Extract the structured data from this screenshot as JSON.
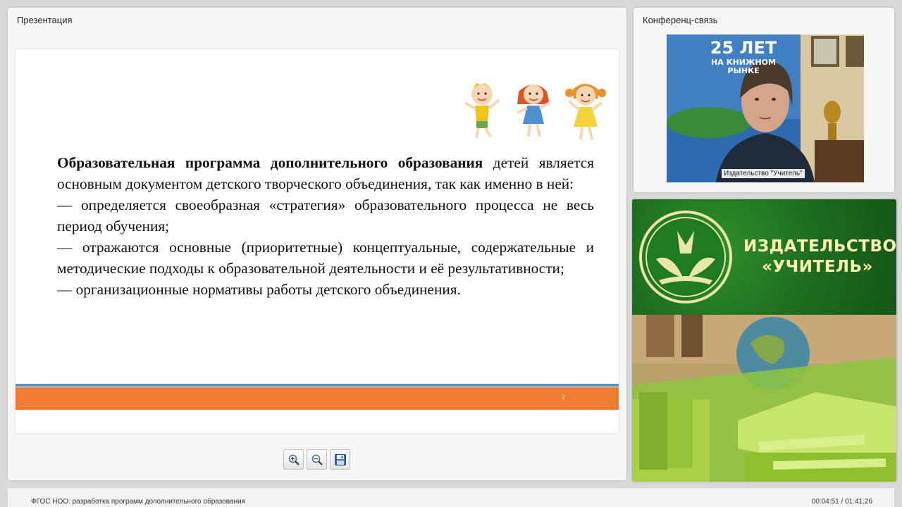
{
  "presentation_panel": {
    "title": "Презентация"
  },
  "slide": {
    "paragraph1_bold": "Образовательная программа дополнительного образования",
    "paragraph1_rest": " детей является основным документом детского творческого объединения, так как именно в ней:",
    "bullet1": "— определяется своеобразная «стратегия» образовательного процесса не весь период обучения;",
    "bullet2": "— отражаются основные (приоритетные) концептуальные, содержательные и методические подходы к образовательной деятельности и её результативности;",
    "bullet3": "— организационные нормативы работы детского объединения.",
    "page_number": "2"
  },
  "toolbar": {
    "zoom_in_icon": "zoom-in-icon",
    "zoom_out_icon": "zoom-out-icon",
    "save_icon": "floppy-disk-icon"
  },
  "conference_panel": {
    "title": "Конференц-связь",
    "participant_label": "Издательство \"Учитель\"",
    "banner_lines": [
      "25 ЛЕТ",
      "НА КНИЖНОМ",
      "РЫНКЕ"
    ]
  },
  "brand": {
    "name_line1": "ИЗДАТЕЛЬСТВО",
    "name_line2": "«УЧИТЕЛЬ»"
  },
  "footer": {
    "course_title": "ФГОС НОО: разработка программ дополнительного образования",
    "time": "00:04:51 / 01:41:26"
  },
  "colors": {
    "accent_orange": "#ef7d31",
    "accent_blue": "#5b8fc3",
    "brand_green": "#1c6a1f",
    "brand_text": "#fff6b0"
  }
}
